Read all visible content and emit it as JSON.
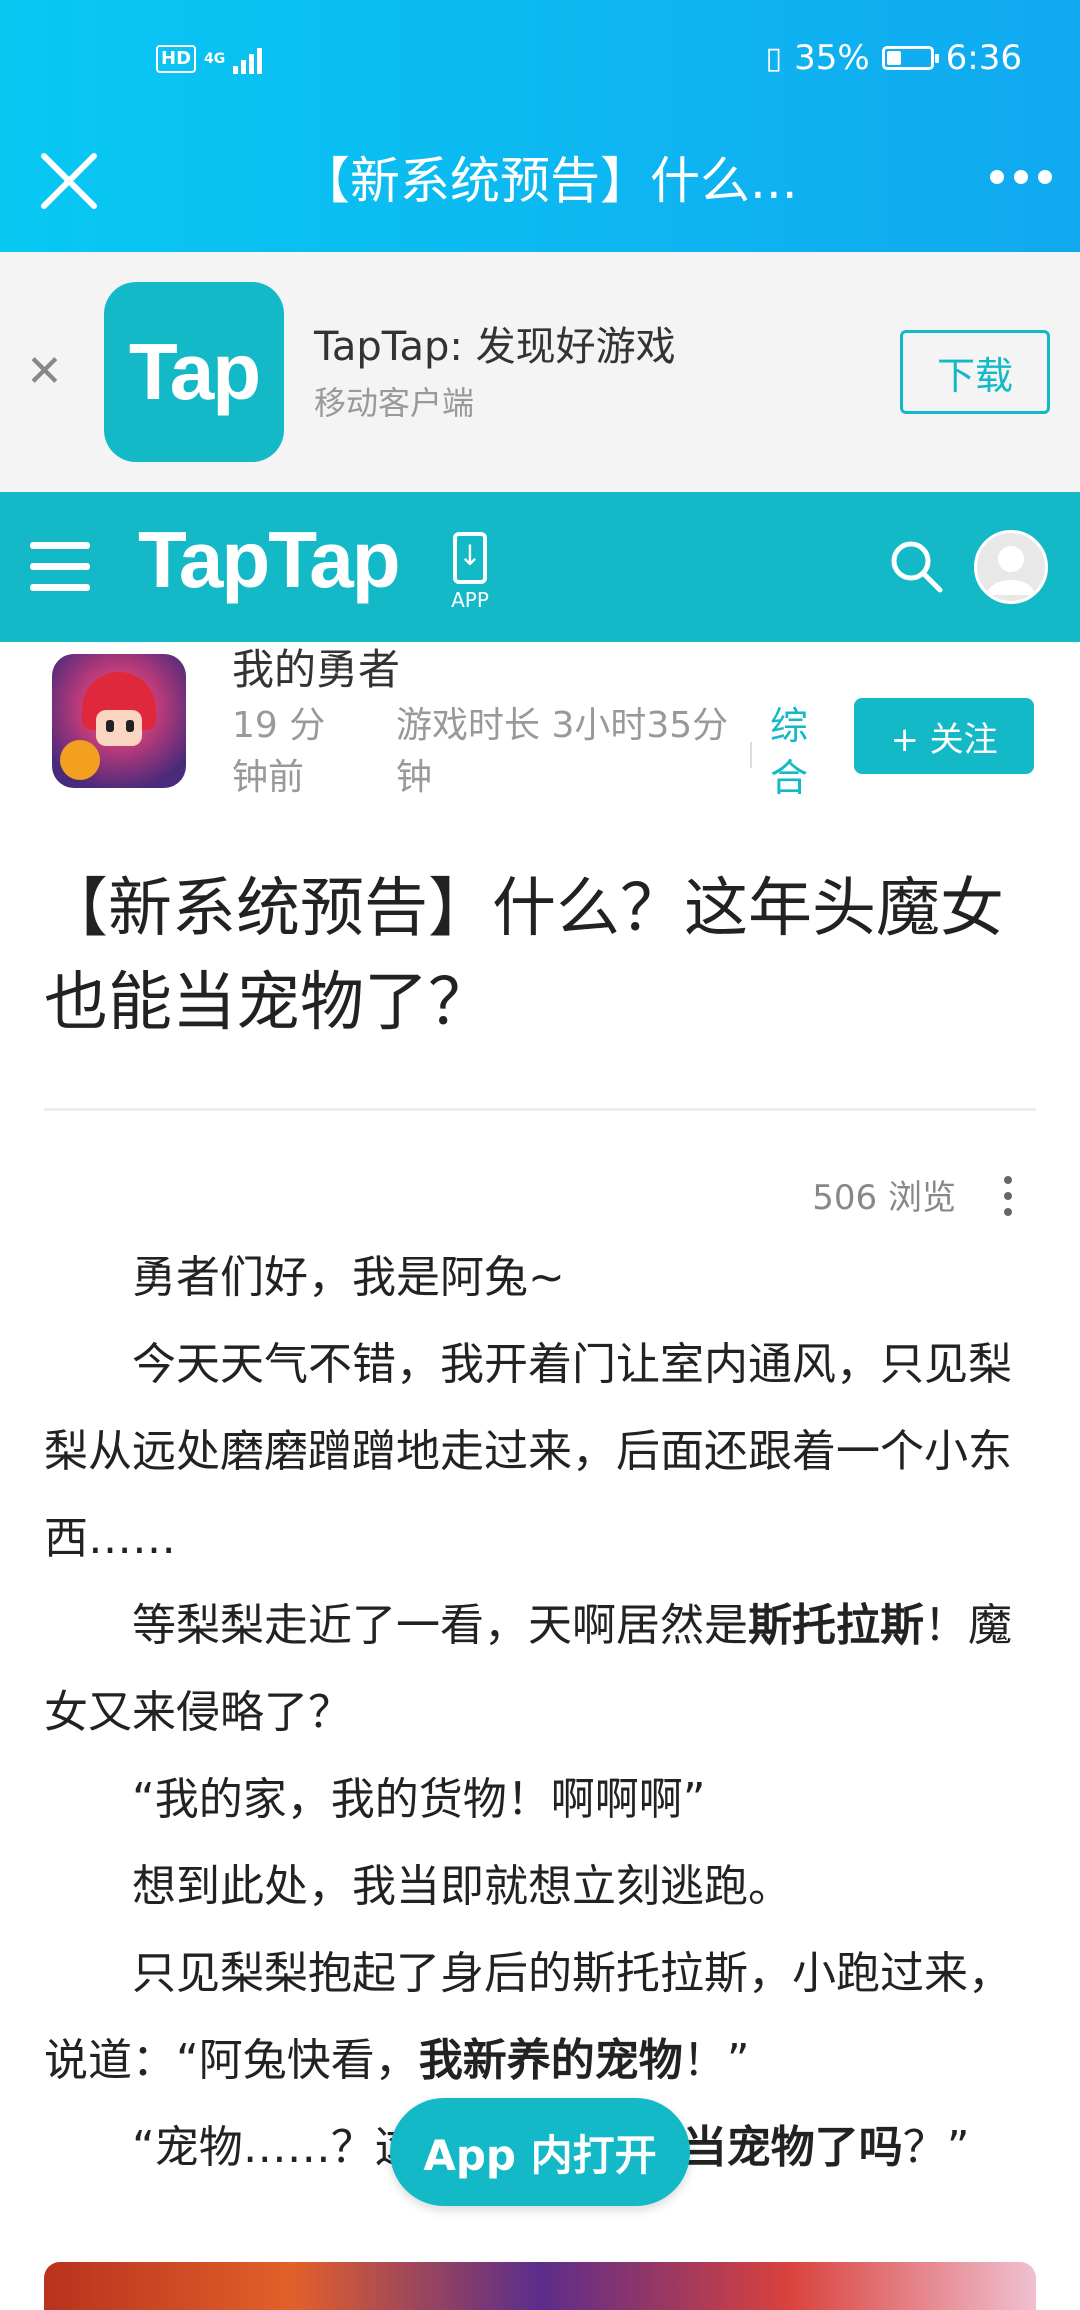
{
  "status_bar": {
    "network_badge": "HD",
    "network_type": "4G",
    "battery_percent": "35%",
    "battery_level": 0.35,
    "time": "6:36"
  },
  "title_bar": {
    "title": "【新系统预告】什么..."
  },
  "app_banner": {
    "logo_text": "Tap",
    "title": "TapTap: 发现好游戏",
    "subtitle": "移动客户端",
    "download_label": "下载"
  },
  "site_header": {
    "brand": "TapTap",
    "app_label": "APP"
  },
  "author": {
    "name": "我的勇者",
    "time_ago": "19 分钟前",
    "play_time": "游戏时长 3小时35分钟",
    "category": "综合",
    "follow_label": "+ 关注"
  },
  "article": {
    "title": "【新系统预告】什么？这年头魔女也能当宠物了？",
    "views": "506 浏览",
    "paragraphs": [
      [
        {
          "t": "勇者们好，我是阿兔~"
        }
      ],
      [
        {
          "t": "今天天气不错，我开着门让室内通风，只见梨梨从远处磨磨蹭蹭地走过来，后面还跟着一个小东西……"
        }
      ],
      [
        {
          "t": "等梨梨走近了一看，天啊居然是"
        },
        {
          "t": "斯托拉斯",
          "b": true
        },
        {
          "t": "！魔女又来侵略了？"
        }
      ],
      [
        {
          "t": "“我的家，我的货物！啊啊啊”"
        }
      ],
      [
        {
          "t": "想到此处，我当即就想立刻逃跑。"
        }
      ],
      [
        {
          "t": "只见梨梨抱起了身后的斯托拉斯，小跑过来，说道：“阿兔快看，"
        },
        {
          "t": "我新养的宠物",
          "b": true
        },
        {
          "t": "！”"
        }
      ],
      [
        {
          "t": "“宠物……？这年头魔女也能"
        },
        {
          "t": "当宠物了吗",
          "b": true
        },
        {
          "t": "？”"
        }
      ]
    ]
  },
  "open_in_app_label": "App 内打开"
}
